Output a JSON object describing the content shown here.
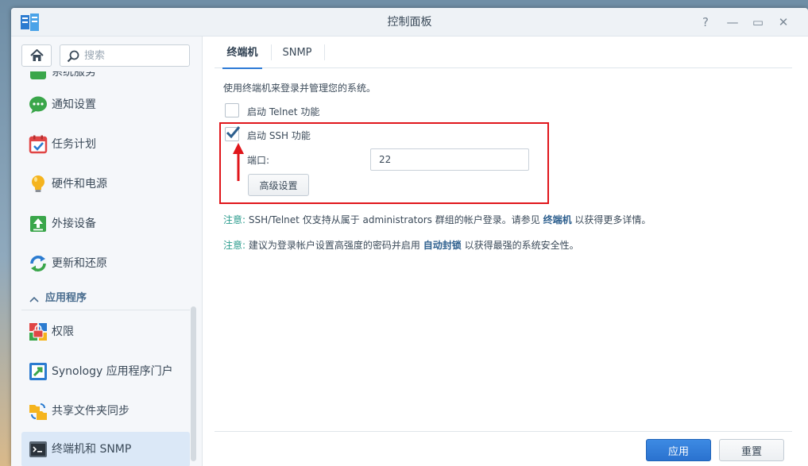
{
  "window": {
    "title": "控制面板",
    "help_glyph": "?",
    "min_glyph": "—",
    "max_glyph": "▭",
    "close_glyph": "✕"
  },
  "sidebar": {
    "search_placeholder": "搜索",
    "cut_item_label": "系统服务",
    "items": [
      {
        "label": "通知设置",
        "icon": "chat-bubble-icon"
      },
      {
        "label": "任务计划",
        "icon": "calendar-icon"
      },
      {
        "label": "硬件和电源",
        "icon": "lightbulb-icon"
      },
      {
        "label": "外接设备",
        "icon": "external-device-icon"
      },
      {
        "label": "更新和还原",
        "icon": "update-icon"
      }
    ],
    "section_label": "应用程序",
    "app_items": [
      {
        "label": "权限",
        "icon": "privileges-icon"
      },
      {
        "label": "Synology 应用程序门户",
        "icon": "app-portal-icon"
      },
      {
        "label": "共享文件夹同步",
        "icon": "folder-sync-icon"
      },
      {
        "label": "终端机和 SNMP",
        "icon": "terminal-icon",
        "active": true
      }
    ]
  },
  "tabs": [
    {
      "label": "终端机",
      "active": true
    },
    {
      "label": "SNMP",
      "active": false
    }
  ],
  "content": {
    "description": "使用终端机来登录并管理您的系统。",
    "telnet_label": "启动 Telnet 功能",
    "telnet_checked": false,
    "ssh_label": "启动 SSH 功能",
    "ssh_checked": true,
    "port_label": "端口:",
    "port_value": "22",
    "advanced_button": "高级设置",
    "note1": {
      "prefix": "注意:",
      "text1": "SSH/Telnet 仅支持从属于 administrators 群组的帐户登录。请参见",
      "link": "终端机",
      "text2": "以获得更多详情。"
    },
    "note2": {
      "prefix": "注意:",
      "text1": "建议为登录帐户设置高强度的密码并启用",
      "link": "自动封锁",
      "text2": "以获得最强的系统安全性。"
    }
  },
  "footer": {
    "apply": "应用",
    "reset": "重置"
  },
  "colors": {
    "accent": "#2a72cf",
    "highlight": "#e0161b",
    "note_key": "#2c9c8e"
  }
}
